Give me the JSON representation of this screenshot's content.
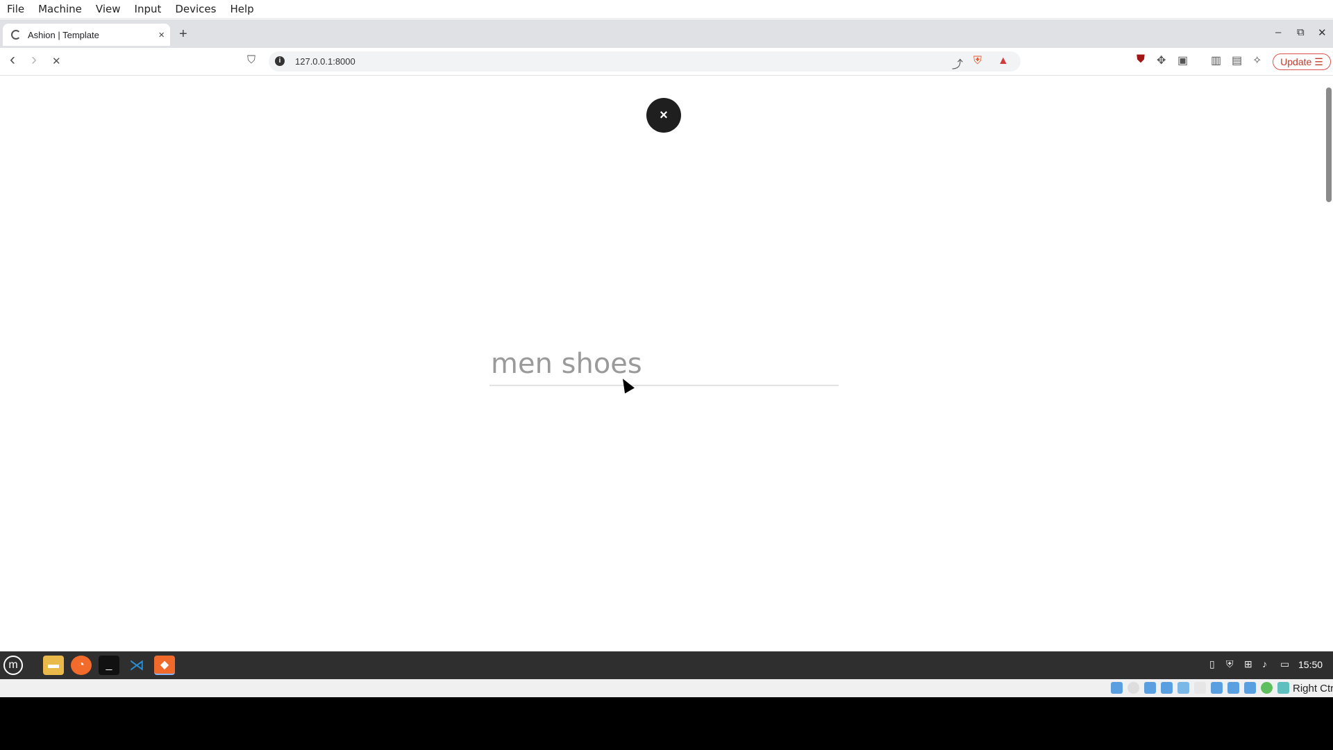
{
  "vbox_menu": [
    "File",
    "Machine",
    "View",
    "Input",
    "Devices",
    "Help"
  ],
  "tab": {
    "title": "Ashion | Template",
    "close": "×"
  },
  "newtab": "+",
  "window_controls": {
    "minimize": "–",
    "restore": "⧉",
    "close": "✕"
  },
  "toolbar": {
    "back": "‹",
    "forward": "›",
    "stop": "✕",
    "bookmark": "⛉",
    "url": "127.0.0.1:8000",
    "update_label": "Update",
    "update_menu": "☰"
  },
  "page": {
    "close_button": "×",
    "search_value": "men shoes"
  },
  "taskbar": {
    "apps": [
      "mint-menu",
      "files",
      "firefox",
      "terminal",
      "vscode",
      "brave"
    ],
    "clock": "15:50"
  },
  "status_bar": {
    "host_key": "Right Ctrl"
  }
}
